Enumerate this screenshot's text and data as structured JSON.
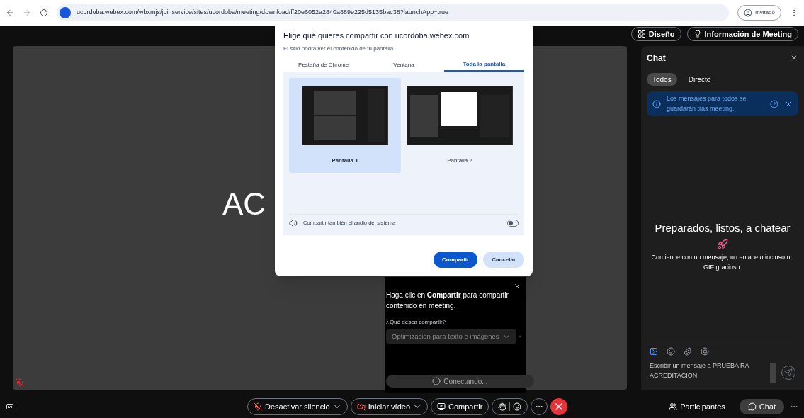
{
  "browser": {
    "url": "ucordoba.webex.com/wbxmjs/joinservice/sites/ucordoba/meeting/download/ff20e6052a2840a889e225d5135bac38?launchApp=true",
    "profile": "Invitado"
  },
  "header_buttons": [
    "Diseño",
    "Información de Meeting"
  ],
  "stage": {
    "text": "AC"
  },
  "share_dialog": {
    "title": "Elige qué quieres compartir con ucordoba.webex.com",
    "subtitle": "El sitio podrá ver el contenido de tu pantalla",
    "tabs": [
      {
        "label": "Pestaña de Chrome",
        "selected": false
      },
      {
        "label": "Ventana",
        "selected": false
      },
      {
        "label": "Toda la pantalla",
        "selected": true
      }
    ],
    "screens": [
      {
        "label": "Pantalla 1",
        "selected": true,
        "kind": "dark"
      },
      {
        "label": "Pantalla 2",
        "selected": false,
        "kind": "dialog"
      }
    ],
    "audio": {
      "label": "Compartir también el audio del sistema",
      "on": false
    },
    "buttons": [
      {
        "label": "Compartir",
        "kind": "primary"
      },
      {
        "label": "Cancelar",
        "kind": "secondary"
      }
    ]
  },
  "share_popup": {
    "message": "Haga clic en **Compartir** para compartir contenido en meeting.",
    "question": "¿Qué desea compartir?",
    "option": "Optimización para texto e imágenes",
    "status": "Conectando..."
  },
  "chat": {
    "title": "Chat",
    "tabs": [
      {
        "label": "Todos",
        "selected": true
      },
      {
        "label": "Directo",
        "selected": false
      }
    ],
    "notice": "Los mensajes para todos se guardarán tras meeting.",
    "empty_title": "Preparados, listos, a chatear",
    "empty_text": "Comience con un mensaje, un enlace o incluso un GIF gracioso.",
    "input_placeholder": "Escribir un mensaje a PRUEBA RA ACREDITACION"
  },
  "controls": [
    {
      "label": "Desactivar silencio",
      "kind": "mute"
    },
    {
      "label": "Iniciar vídeo",
      "kind": "video"
    },
    {
      "label": "Compartir",
      "kind": "share"
    }
  ],
  "right_controls": [
    {
      "label": "Participantes",
      "selected": false
    },
    {
      "label": "Chat",
      "selected": true
    }
  ]
}
